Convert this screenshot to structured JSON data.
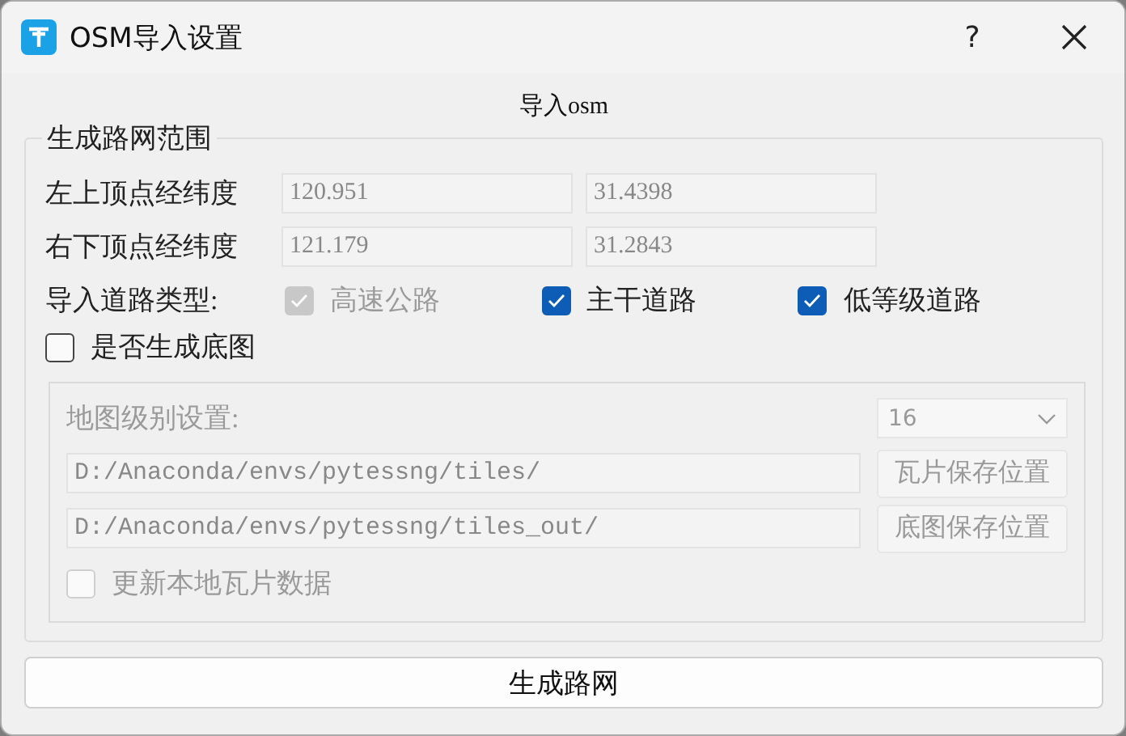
{
  "window": {
    "title": "OSM导入设置",
    "help": "?"
  },
  "heading": "导入osm",
  "range_group": {
    "title": "生成路网范围",
    "rows": [
      {
        "label": "左上顶点经纬度",
        "lon": "120.951",
        "lat": "31.4398"
      },
      {
        "label": "右下顶点经纬度",
        "lon": "121.179",
        "lat": "31.2843"
      }
    ],
    "road_types": {
      "label": "导入道路类型:",
      "options": [
        {
          "label": "高速公路",
          "checked": true,
          "disabled": true
        },
        {
          "label": "主干道路",
          "checked": true,
          "disabled": false
        },
        {
          "label": "低等级道路",
          "checked": true,
          "disabled": false
        }
      ]
    },
    "generate_basemap": {
      "label": "是否生成底图",
      "checked": false
    },
    "basemap": {
      "disabled": true,
      "level_label": "地图级别设置:",
      "level_value": "16",
      "paths": [
        {
          "value": "D:/Anaconda/envs/pytessng/tiles/",
          "button": "瓦片保存位置"
        },
        {
          "value": "D:/Anaconda/envs/pytessng/tiles_out/",
          "button": "底图保存位置"
        }
      ],
      "update_tiles": {
        "label": "更新本地瓦片数据",
        "checked": false
      }
    }
  },
  "generate_button": "生成路网"
}
